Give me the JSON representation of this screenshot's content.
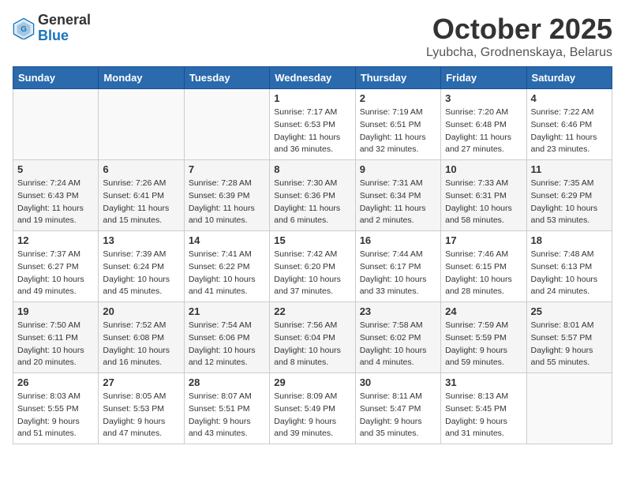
{
  "header": {
    "logo_general": "General",
    "logo_blue": "Blue",
    "month_title": "October 2025",
    "subtitle": "Lyubcha, Grodnenskaya, Belarus"
  },
  "days_of_week": [
    "Sunday",
    "Monday",
    "Tuesday",
    "Wednesday",
    "Thursday",
    "Friday",
    "Saturday"
  ],
  "weeks": [
    [
      {
        "day": "",
        "sunrise": "",
        "sunset": "",
        "daylight": ""
      },
      {
        "day": "",
        "sunrise": "",
        "sunset": "",
        "daylight": ""
      },
      {
        "day": "",
        "sunrise": "",
        "sunset": "",
        "daylight": ""
      },
      {
        "day": "1",
        "sunrise": "Sunrise: 7:17 AM",
        "sunset": "Sunset: 6:53 PM",
        "daylight": "Daylight: 11 hours and 36 minutes."
      },
      {
        "day": "2",
        "sunrise": "Sunrise: 7:19 AM",
        "sunset": "Sunset: 6:51 PM",
        "daylight": "Daylight: 11 hours and 32 minutes."
      },
      {
        "day": "3",
        "sunrise": "Sunrise: 7:20 AM",
        "sunset": "Sunset: 6:48 PM",
        "daylight": "Daylight: 11 hours and 27 minutes."
      },
      {
        "day": "4",
        "sunrise": "Sunrise: 7:22 AM",
        "sunset": "Sunset: 6:46 PM",
        "daylight": "Daylight: 11 hours and 23 minutes."
      }
    ],
    [
      {
        "day": "5",
        "sunrise": "Sunrise: 7:24 AM",
        "sunset": "Sunset: 6:43 PM",
        "daylight": "Daylight: 11 hours and 19 minutes."
      },
      {
        "day": "6",
        "sunrise": "Sunrise: 7:26 AM",
        "sunset": "Sunset: 6:41 PM",
        "daylight": "Daylight: 11 hours and 15 minutes."
      },
      {
        "day": "7",
        "sunrise": "Sunrise: 7:28 AM",
        "sunset": "Sunset: 6:39 PM",
        "daylight": "Daylight: 11 hours and 10 minutes."
      },
      {
        "day": "8",
        "sunrise": "Sunrise: 7:30 AM",
        "sunset": "Sunset: 6:36 PM",
        "daylight": "Daylight: 11 hours and 6 minutes."
      },
      {
        "day": "9",
        "sunrise": "Sunrise: 7:31 AM",
        "sunset": "Sunset: 6:34 PM",
        "daylight": "Daylight: 11 hours and 2 minutes."
      },
      {
        "day": "10",
        "sunrise": "Sunrise: 7:33 AM",
        "sunset": "Sunset: 6:31 PM",
        "daylight": "Daylight: 10 hours and 58 minutes."
      },
      {
        "day": "11",
        "sunrise": "Sunrise: 7:35 AM",
        "sunset": "Sunset: 6:29 PM",
        "daylight": "Daylight: 10 hours and 53 minutes."
      }
    ],
    [
      {
        "day": "12",
        "sunrise": "Sunrise: 7:37 AM",
        "sunset": "Sunset: 6:27 PM",
        "daylight": "Daylight: 10 hours and 49 minutes."
      },
      {
        "day": "13",
        "sunrise": "Sunrise: 7:39 AM",
        "sunset": "Sunset: 6:24 PM",
        "daylight": "Daylight: 10 hours and 45 minutes."
      },
      {
        "day": "14",
        "sunrise": "Sunrise: 7:41 AM",
        "sunset": "Sunset: 6:22 PM",
        "daylight": "Daylight: 10 hours and 41 minutes."
      },
      {
        "day": "15",
        "sunrise": "Sunrise: 7:42 AM",
        "sunset": "Sunset: 6:20 PM",
        "daylight": "Daylight: 10 hours and 37 minutes."
      },
      {
        "day": "16",
        "sunrise": "Sunrise: 7:44 AM",
        "sunset": "Sunset: 6:17 PM",
        "daylight": "Daylight: 10 hours and 33 minutes."
      },
      {
        "day": "17",
        "sunrise": "Sunrise: 7:46 AM",
        "sunset": "Sunset: 6:15 PM",
        "daylight": "Daylight: 10 hours and 28 minutes."
      },
      {
        "day": "18",
        "sunrise": "Sunrise: 7:48 AM",
        "sunset": "Sunset: 6:13 PM",
        "daylight": "Daylight: 10 hours and 24 minutes."
      }
    ],
    [
      {
        "day": "19",
        "sunrise": "Sunrise: 7:50 AM",
        "sunset": "Sunset: 6:11 PM",
        "daylight": "Daylight: 10 hours and 20 minutes."
      },
      {
        "day": "20",
        "sunrise": "Sunrise: 7:52 AM",
        "sunset": "Sunset: 6:08 PM",
        "daylight": "Daylight: 10 hours and 16 minutes."
      },
      {
        "day": "21",
        "sunrise": "Sunrise: 7:54 AM",
        "sunset": "Sunset: 6:06 PM",
        "daylight": "Daylight: 10 hours and 12 minutes."
      },
      {
        "day": "22",
        "sunrise": "Sunrise: 7:56 AM",
        "sunset": "Sunset: 6:04 PM",
        "daylight": "Daylight: 10 hours and 8 minutes."
      },
      {
        "day": "23",
        "sunrise": "Sunrise: 7:58 AM",
        "sunset": "Sunset: 6:02 PM",
        "daylight": "Daylight: 10 hours and 4 minutes."
      },
      {
        "day": "24",
        "sunrise": "Sunrise: 7:59 AM",
        "sunset": "Sunset: 5:59 PM",
        "daylight": "Daylight: 9 hours and 59 minutes."
      },
      {
        "day": "25",
        "sunrise": "Sunrise: 8:01 AM",
        "sunset": "Sunset: 5:57 PM",
        "daylight": "Daylight: 9 hours and 55 minutes."
      }
    ],
    [
      {
        "day": "26",
        "sunrise": "Sunrise: 8:03 AM",
        "sunset": "Sunset: 5:55 PM",
        "daylight": "Daylight: 9 hours and 51 minutes."
      },
      {
        "day": "27",
        "sunrise": "Sunrise: 8:05 AM",
        "sunset": "Sunset: 5:53 PM",
        "daylight": "Daylight: 9 hours and 47 minutes."
      },
      {
        "day": "28",
        "sunrise": "Sunrise: 8:07 AM",
        "sunset": "Sunset: 5:51 PM",
        "daylight": "Daylight: 9 hours and 43 minutes."
      },
      {
        "day": "29",
        "sunrise": "Sunrise: 8:09 AM",
        "sunset": "Sunset: 5:49 PM",
        "daylight": "Daylight: 9 hours and 39 minutes."
      },
      {
        "day": "30",
        "sunrise": "Sunrise: 8:11 AM",
        "sunset": "Sunset: 5:47 PM",
        "daylight": "Daylight: 9 hours and 35 minutes."
      },
      {
        "day": "31",
        "sunrise": "Sunrise: 8:13 AM",
        "sunset": "Sunset: 5:45 PM",
        "daylight": "Daylight: 9 hours and 31 minutes."
      },
      {
        "day": "",
        "sunrise": "",
        "sunset": "",
        "daylight": ""
      }
    ]
  ]
}
